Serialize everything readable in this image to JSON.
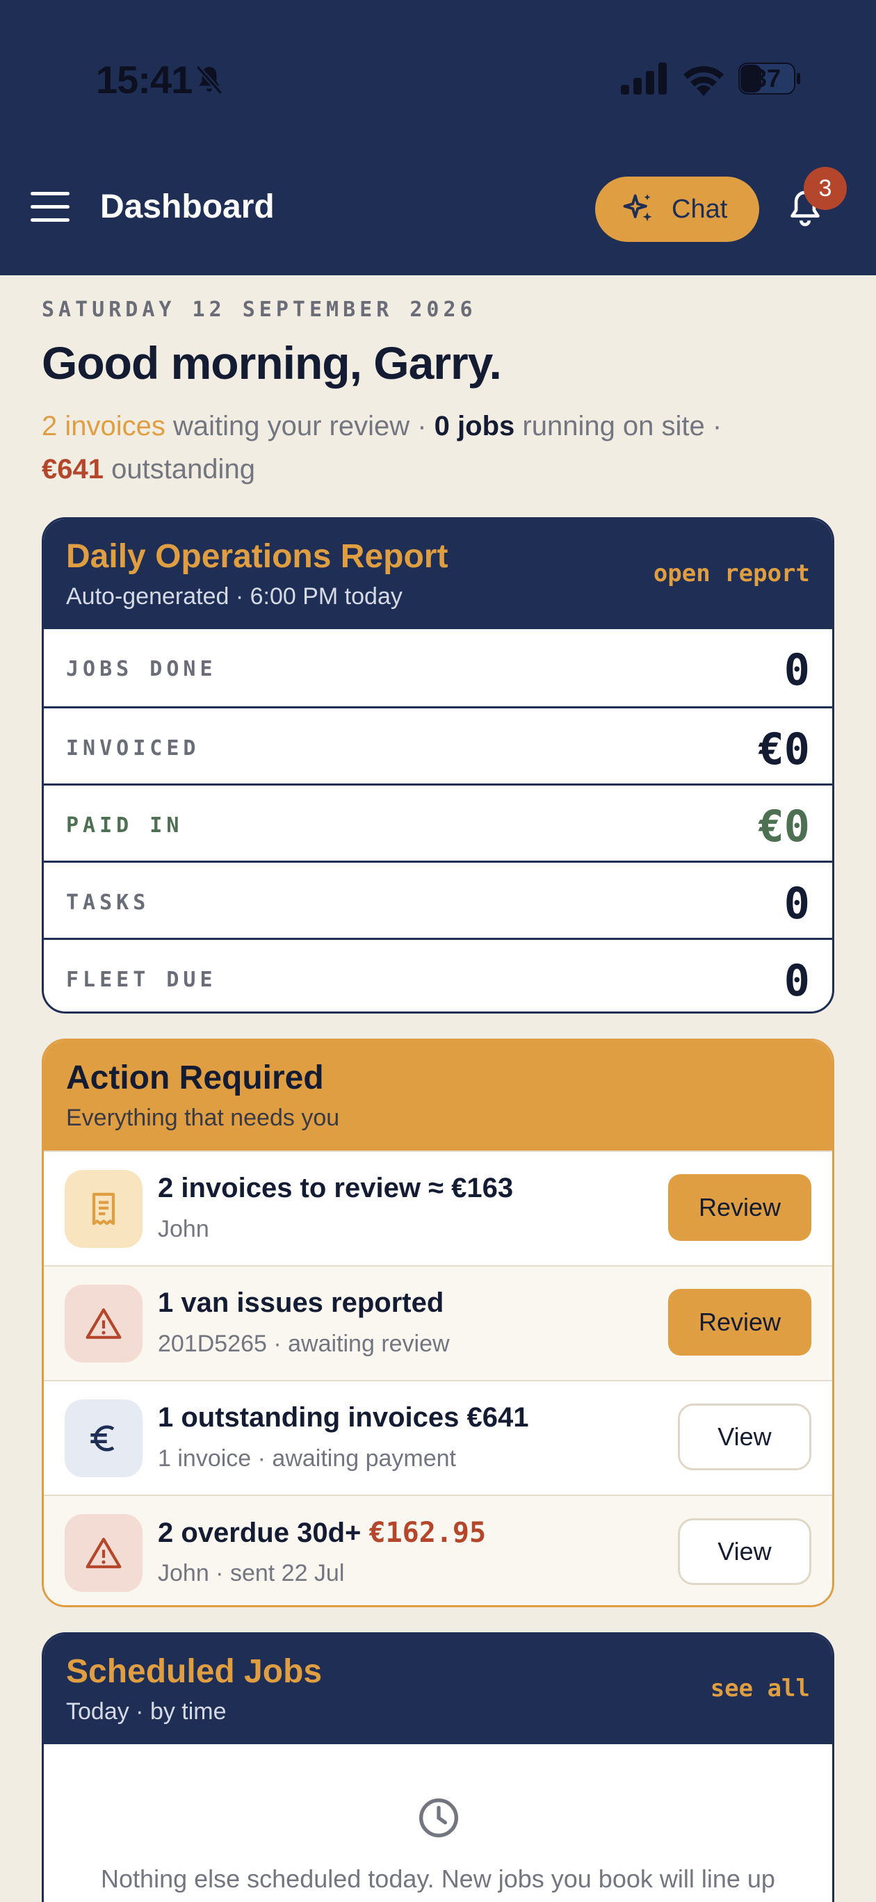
{
  "status_bar": {
    "time": "15:41",
    "battery": "37"
  },
  "header": {
    "title": "Dashboard",
    "chat_label": "Chat",
    "notification_count": "3"
  },
  "greeting": {
    "date": "SATURDAY 12 SEPTEMBER 2026",
    "text": "Good morning, Garry.",
    "invoices": "2 invoices",
    "invoices_tail": " waiting your review · ",
    "jobs": "0 jobs",
    "jobs_tail": " running on site ·",
    "outstanding": "€641",
    "outstanding_tail": " outstanding"
  },
  "report": {
    "title": "Daily Operations Report",
    "subtitle": "Auto-generated · 6:00 PM today",
    "link": "open report",
    "rows": [
      {
        "label": "JOBS DONE",
        "value": "0"
      },
      {
        "label": "INVOICED",
        "value": "€0"
      },
      {
        "label": "PAID IN",
        "value": "€0"
      },
      {
        "label": "TASKS",
        "value": "0"
      },
      {
        "label": "FLEET DUE",
        "value": "0"
      }
    ]
  },
  "actions": {
    "title": "Action Required",
    "subtitle": "Everything that needs you",
    "items": [
      {
        "title": "2 invoices to review ≈  €163",
        "subtitle": "John",
        "button": "Review"
      },
      {
        "title": "1 van issues reported",
        "subtitle": "201D5265 · awaiting review",
        "button": "Review"
      },
      {
        "title": "1 outstanding invoices €641",
        "subtitle": "1 invoice · awaiting payment",
        "button": "View"
      },
      {
        "title": "2 overdue 30d+ ",
        "amount": "€162.95",
        "subtitle": "John · sent 22 Jul",
        "button": "View"
      }
    ]
  },
  "scheduled": {
    "title": "Scheduled Jobs",
    "subtitle": "Today · by time",
    "link": "see all",
    "empty_message": "Nothing else scheduled today. New jobs you book will line up here."
  },
  "colors": {
    "navy": "#1e2e55",
    "accent": "#e09e42",
    "danger": "#b4472b",
    "success": "#4e7052",
    "background": "#f2ede3"
  }
}
